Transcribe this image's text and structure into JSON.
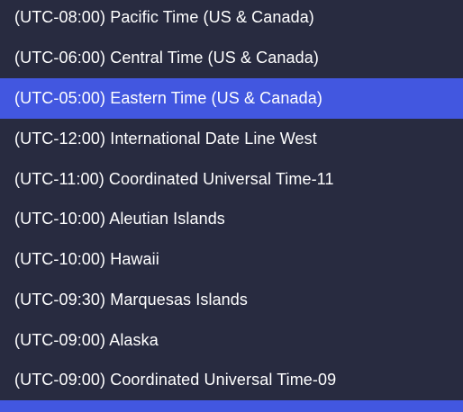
{
  "timezone_dropdown": {
    "selected_index": 2,
    "accent_color": "#4257e0",
    "background_color": "#282b40",
    "options": [
      "(UTC-08:00) Pacific Time (US & Canada)",
      "(UTC-06:00) Central Time (US & Canada)",
      "(UTC-05:00) Eastern Time (US & Canada)",
      "(UTC-12:00) International Date Line West",
      "(UTC-11:00) Coordinated Universal Time-11",
      "(UTC-10:00) Aleutian Islands",
      "(UTC-10:00) Hawaii",
      "(UTC-09:30) Marquesas Islands",
      "(UTC-09:00) Alaska",
      "(UTC-09:00) Coordinated Universal Time-09"
    ]
  }
}
